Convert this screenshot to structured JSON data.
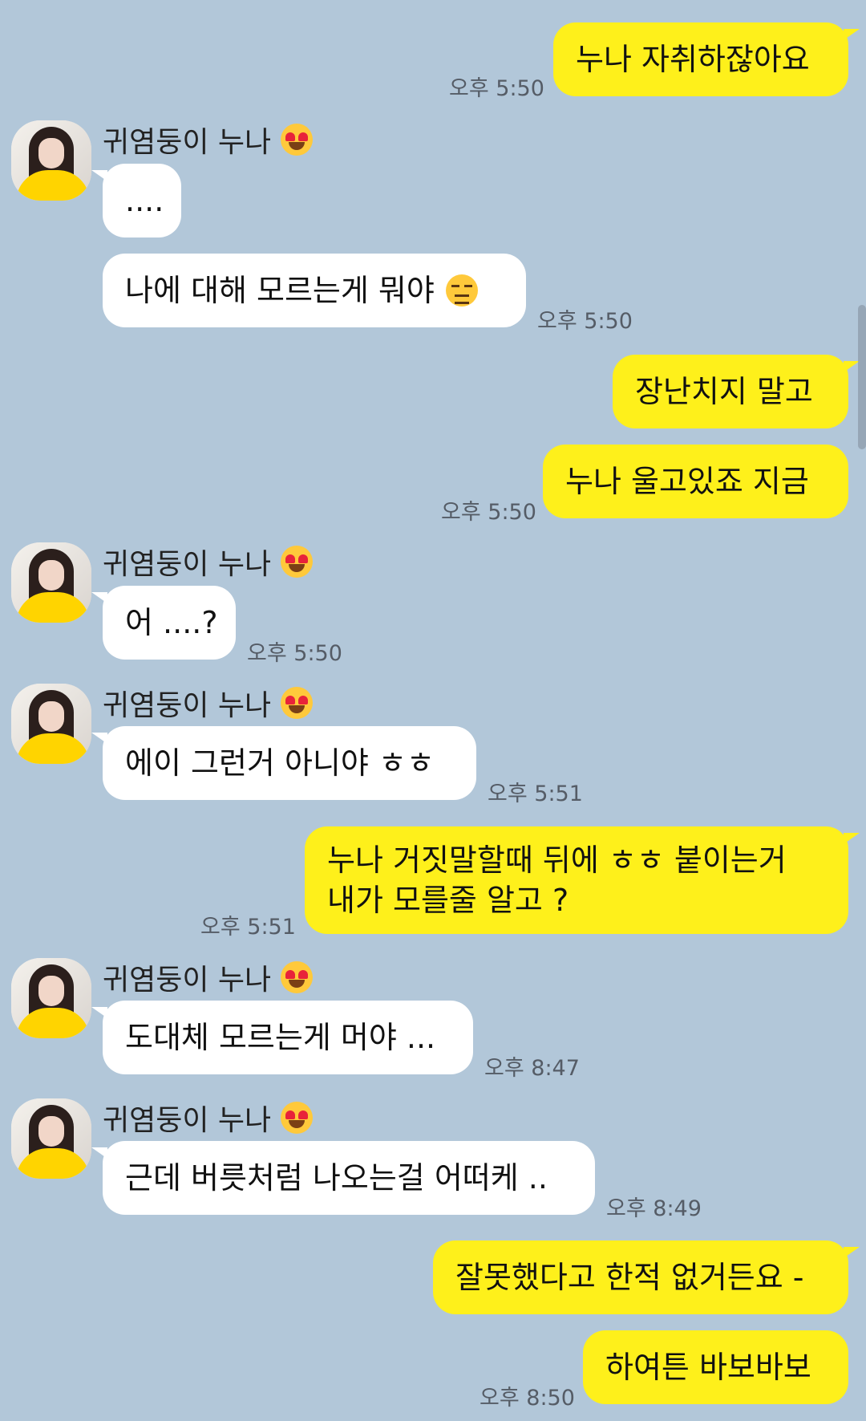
{
  "contact": {
    "name": "귀염둥이 누나"
  },
  "messages": {
    "m1": "누나 자취하잖아요",
    "m2": "....",
    "m3": "나에 대해 모르는게 뭐야",
    "m4": "장난치지 말고",
    "m5": "누나 울고있죠 지금",
    "m6": "어 ....?",
    "m7": "에이 그런거 아니야 ㅎㅎ",
    "m8a": "누나 거짓말할때 뒤에 ㅎㅎ 붙이는거",
    "m8b": "내가 모를줄 알고 ?",
    "m9": "도대체 모르는게 머야 ...",
    "m10": "근데 버릇처럼 나오는걸 어떠케 ..",
    "m11": "잘못했다고 한적 없거든요 -",
    "m12": "하여튼 바보바보"
  },
  "times": {
    "t1": "오후 5:50",
    "t3": "오후 5:50",
    "t5": "오후 5:50",
    "t6": "오후 5:50",
    "t7": "오후 5:51",
    "t8": "오후 5:51",
    "t9": "오후 8:47",
    "t10": "오후 8:49",
    "t12": "오후 8:50"
  },
  "icons": {
    "name_emoji": "heart-eyes-emoji-icon",
    "m3_emoji": "confounded-emoji-icon"
  }
}
